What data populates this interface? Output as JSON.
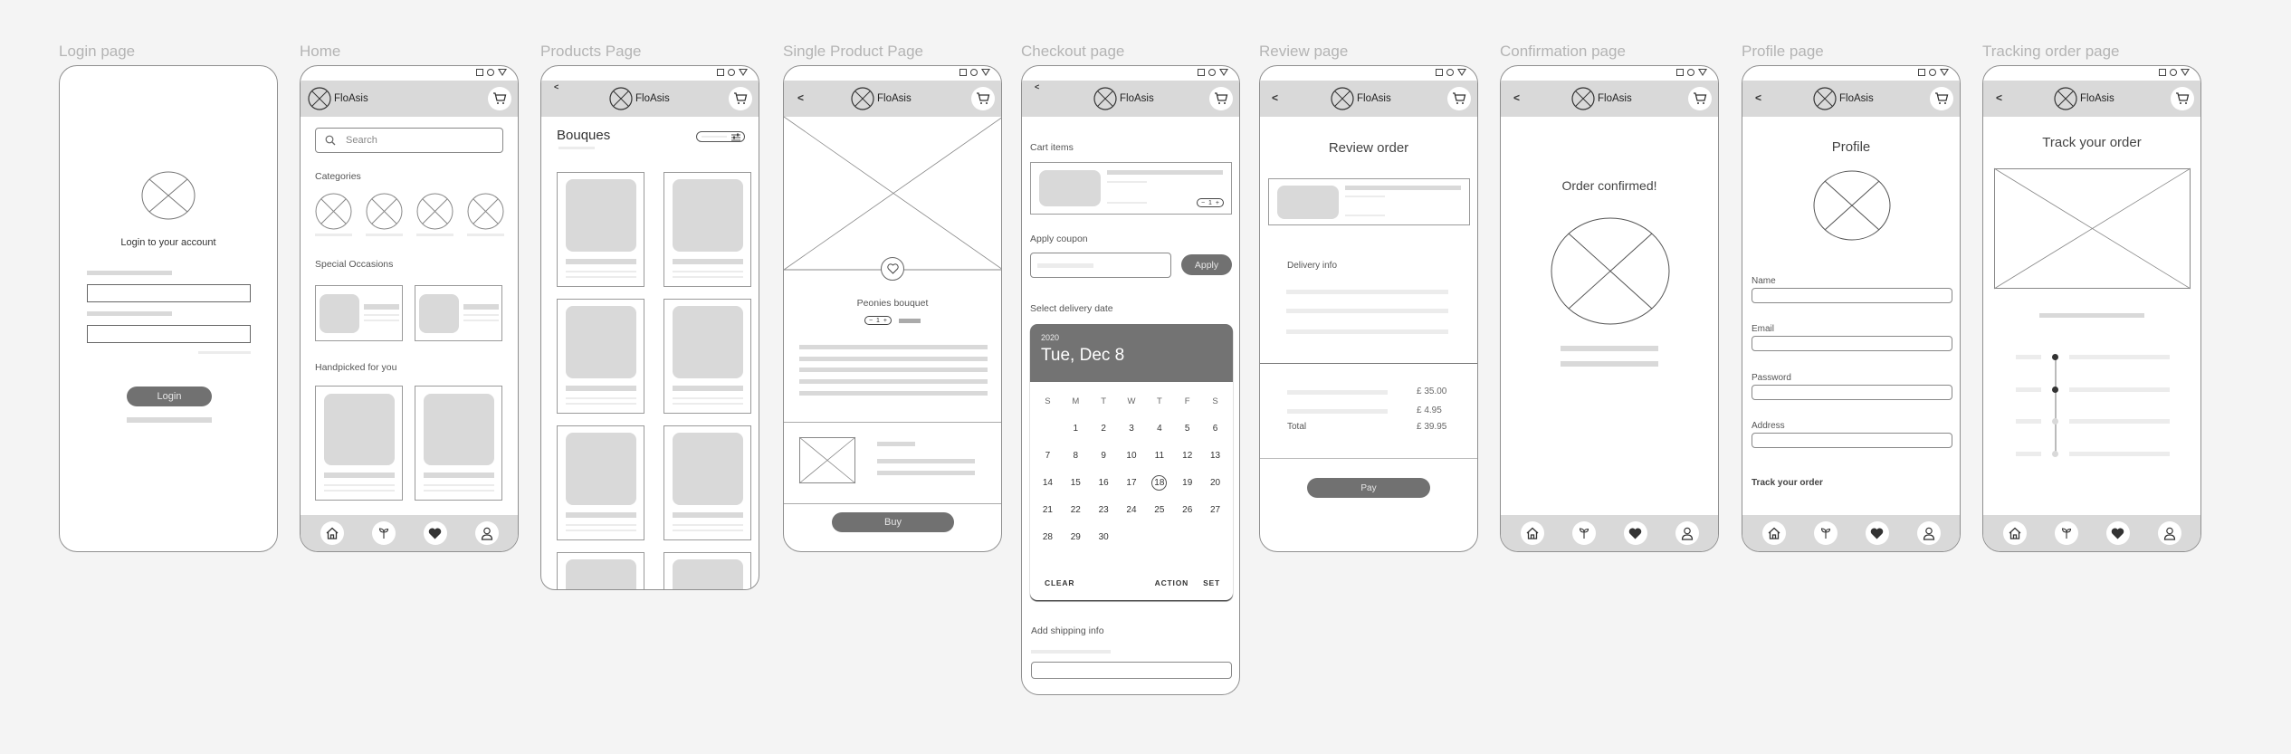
{
  "brand": {
    "name": "FloAsis",
    "accent": "#717171",
    "header_bg": "#d9d9d9",
    "placeholder": "#d9d9d9"
  },
  "frames": [
    {
      "label": "Login page"
    },
    {
      "label": "Home"
    },
    {
      "label": "Products Page"
    },
    {
      "label": "Single Product Page"
    },
    {
      "label": "Checkout page"
    },
    {
      "label": "Review page"
    },
    {
      "label": "Confirmation page"
    },
    {
      "label": "Profile page"
    },
    {
      "label": "Tracking order page"
    }
  ],
  "icons": {
    "status": [
      "square-icon",
      "circle-icon",
      "triangle-icon"
    ],
    "header": [
      "logo-placeholder-icon",
      "cart-icon",
      "back-chevron-icon"
    ],
    "nav": [
      "home-icon",
      "plant-icon",
      "heart-icon",
      "user-icon"
    ]
  },
  "nav_back": "<",
  "login": {
    "title": "Login to your account",
    "login_button": "Login"
  },
  "home": {
    "search_placeholder": "Search",
    "categories_label": "Categories",
    "special_occasions_label": "Special Occasions",
    "handpicked_label": "Handpicked for you"
  },
  "products": {
    "title": "Bouques"
  },
  "single_product": {
    "product_name": "Peonies bouquet",
    "quantity": "1",
    "minus": "−",
    "plus": "+",
    "buy_button": "Buy"
  },
  "checkout": {
    "cart_items_label": "Cart items",
    "quantity": "1",
    "minus": "−",
    "plus": "+",
    "apply_coupon_label": "Apply coupon",
    "apply_button": "Apply",
    "delivery_date_label": "Select delivery date",
    "calendar": {
      "year": "2020",
      "selected_date": "Tue, Dec 8",
      "weekdays": [
        "S",
        "M",
        "T",
        "W",
        "T",
        "F",
        "S"
      ],
      "days": [
        "",
        "1",
        "2",
        "3",
        "4",
        "5",
        "6",
        "7",
        "8",
        "9",
        "10",
        "11",
        "12",
        "13",
        "14",
        "15",
        "16",
        "17",
        "18",
        "19",
        "20",
        "21",
        "22",
        "23",
        "24",
        "25",
        "26",
        "27",
        "28",
        "29",
        "30"
      ],
      "highlighted_day": "18",
      "clear": "CLEAR",
      "action": "ACTION",
      "set": "SET"
    },
    "shipping_label": "Add shipping info"
  },
  "review": {
    "title": "Review order",
    "delivery_info_label": "Delivery info",
    "subtotal": "£ 35.00",
    "shipping": "£ 4.95",
    "total_label": "Total",
    "total": "£ 39.95",
    "pay_button": "Pay"
  },
  "confirmation": {
    "title": "Order confirmed!"
  },
  "profile": {
    "title": "Profile",
    "fields": [
      {
        "label": "Name",
        "value": ""
      },
      {
        "label": "Email",
        "value": ""
      },
      {
        "label": "Password",
        "value": ""
      },
      {
        "label": "Address",
        "value": ""
      }
    ],
    "track_link": "Track your order"
  },
  "tracking": {
    "title": "Track your order",
    "steps_completed": 2,
    "steps_total": 4
  }
}
